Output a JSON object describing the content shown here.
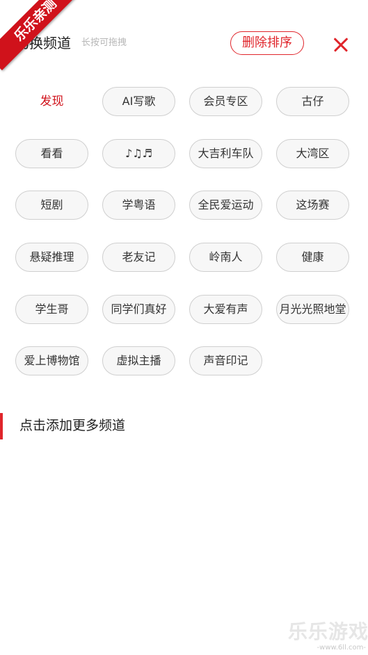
{
  "header": {
    "title": "切换频道",
    "hint": "长按可拖拽",
    "sort_label": "删除排序"
  },
  "channels": [
    {
      "label": "发现",
      "active": true
    },
    {
      "label": "AI写歌"
    },
    {
      "label": "会员专区"
    },
    {
      "label": "古仔"
    },
    {
      "label": "看看"
    },
    {
      "label": "♪♫♬"
    },
    {
      "label": "大吉利车队"
    },
    {
      "label": "大湾区"
    },
    {
      "label": "短剧"
    },
    {
      "label": "学粤语"
    },
    {
      "label": "全民爱运动"
    },
    {
      "label": "这场赛"
    },
    {
      "label": "悬疑推理"
    },
    {
      "label": "老友记"
    },
    {
      "label": "岭南人"
    },
    {
      "label": "健康"
    },
    {
      "label": "学生哥"
    },
    {
      "label": "同学们真好"
    },
    {
      "label": "大爱有声"
    },
    {
      "label": "月光光照地堂"
    },
    {
      "label": "爱上博物馆"
    },
    {
      "label": "虚拟主播"
    },
    {
      "label": "声音印记"
    }
  ],
  "more_section": {
    "label": "点击添加更多频道"
  },
  "badge": {
    "text": "乐乐亲测"
  },
  "watermark": {
    "text": "乐乐游戏",
    "url": "-www.6ll.com-"
  },
  "colors": {
    "accent": "#e0252b",
    "active_text": "#d0121b",
    "chip_border": "#cfcfcf",
    "chip_bg": "#f7f7f7"
  }
}
